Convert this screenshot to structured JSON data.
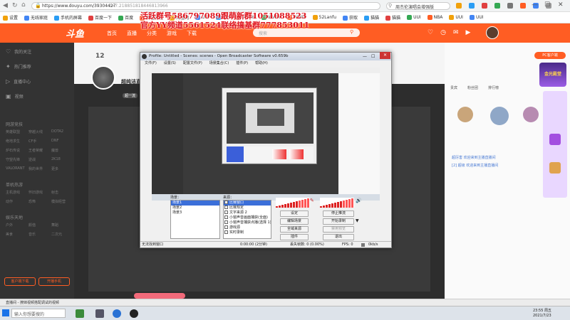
{
  "browser": {
    "url": "https://www.douyu.com/39304427",
    "url_suffix": "?=7.218851818446813966",
    "right_search": "周杰伦演唱会增强版",
    "bookmarks": [
      "设置",
      "无线家庭",
      "手机的屏幕",
      "百度一下",
      "百度",
      "网址导航",
      "淘宝网",
      "UUI",
      "UUI",
      "WWW",
      "WWW",
      "WWW",
      "52Lanfu",
      "获取",
      "猫猫",
      "猫猫",
      "UUI",
      "NBA",
      "UUI",
      "UUI"
    ]
  },
  "overlay": {
    "line1": "活跃群号586797089跟萌新群1051088523",
    "line2": "官方YY频道5561524联络搞基群777853011"
  },
  "site": {
    "logo": "斗鱼",
    "nav": [
      "首页",
      "直播",
      "分类",
      "游戏",
      "下载"
    ],
    "search_placeholder": "搜索",
    "pc_client": "PC客户端"
  },
  "sidebar": {
    "items": [
      {
        "label": "我的关注",
        "icon": "heart-icon"
      },
      {
        "label": "热门推荐",
        "icon": "fire-icon"
      },
      {
        "label": "直播中心",
        "icon": "play-icon"
      },
      {
        "label": "视频",
        "icon": "video-icon"
      }
    ],
    "sections": [
      {
        "title": "网游竞技",
        "subs": [
          "英雄联盟",
          "穿越火线",
          "DOTA2",
          "绝地求生",
          "CF手",
          "DNF",
          "炉石传说",
          "王者荣耀",
          "魔兽",
          "守望先锋",
          "逆战",
          "2K18",
          "VALORANT",
          "我的世界",
          "更多"
        ]
      },
      {
        "title": "单机热游",
        "subs": [
          "主机游戏",
          "怀旧游戏",
          "射击",
          "动作",
          "恐怖",
          "模拟经营"
        ]
      },
      {
        "title": "娱乐天地",
        "subs": [
          "户外",
          "颜值",
          "舞蹈",
          "美食",
          "音乐",
          "二次元"
        ]
      }
    ],
    "footer_buttons": [
      "客户端下载",
      "开播手机"
    ]
  },
  "streamer": {
    "title": "超纯洁直播",
    "tag": "超一流",
    "level": "12"
  },
  "obs": {
    "title": "Profile: Untitled - Scenes: scenes - Open Broadcaster Software v0.659b",
    "menu": [
      "文件(F)",
      "设置(S)",
      "配置文件(P)",
      "场景集合(C)",
      "插件(P)",
      "帮助(H)"
    ],
    "scenes_label": "场景：",
    "scenes": [
      "场景1",
      "场景2",
      "场景3"
    ],
    "sources_label": "来源：",
    "sources": [
      "比赛窗口",
      "比赛规定",
      "文字来源 2",
      "小窗声音画面捕获(全面)",
      "小窗声音捕获点播(选择 1)",
      "游戏源",
      "实时录制"
    ],
    "buttons": {
      "settings": "设定",
      "stop_stream": "停止推流",
      "edit_scene": "编辑场景",
      "start_record": "开始录制",
      "global_sources": "全域来源",
      "plugins": "插件",
      "exit": "退出",
      "preview_disable": "禁用预览"
    },
    "status": {
      "left": "无法找到窗口",
      "time": "0:00:00 (2分钟)",
      "dropped": "丢失帧数: 0 (0.00%)",
      "fps": "FPS: 0",
      "kbps": "0kb/s"
    }
  },
  "right_panel": {
    "badge": "金光殿堂",
    "tabs": [
      "贵宾",
      "粉丝团",
      "排行榜"
    ],
    "chat": [
      "超厉害 欢迎来到主播直播间",
      "[2] 超级 欢迎来到主播直播间"
    ]
  },
  "taskbar": {
    "search": "输入你想要搜的",
    "tab1": "直播间 - 撩妹视频搭配调试的视频",
    "time": "23:55 周五",
    "date": "2021/7/23"
  },
  "colors": {
    "accent": "#ff5d23",
    "overlay_red": "#e0141e"
  }
}
